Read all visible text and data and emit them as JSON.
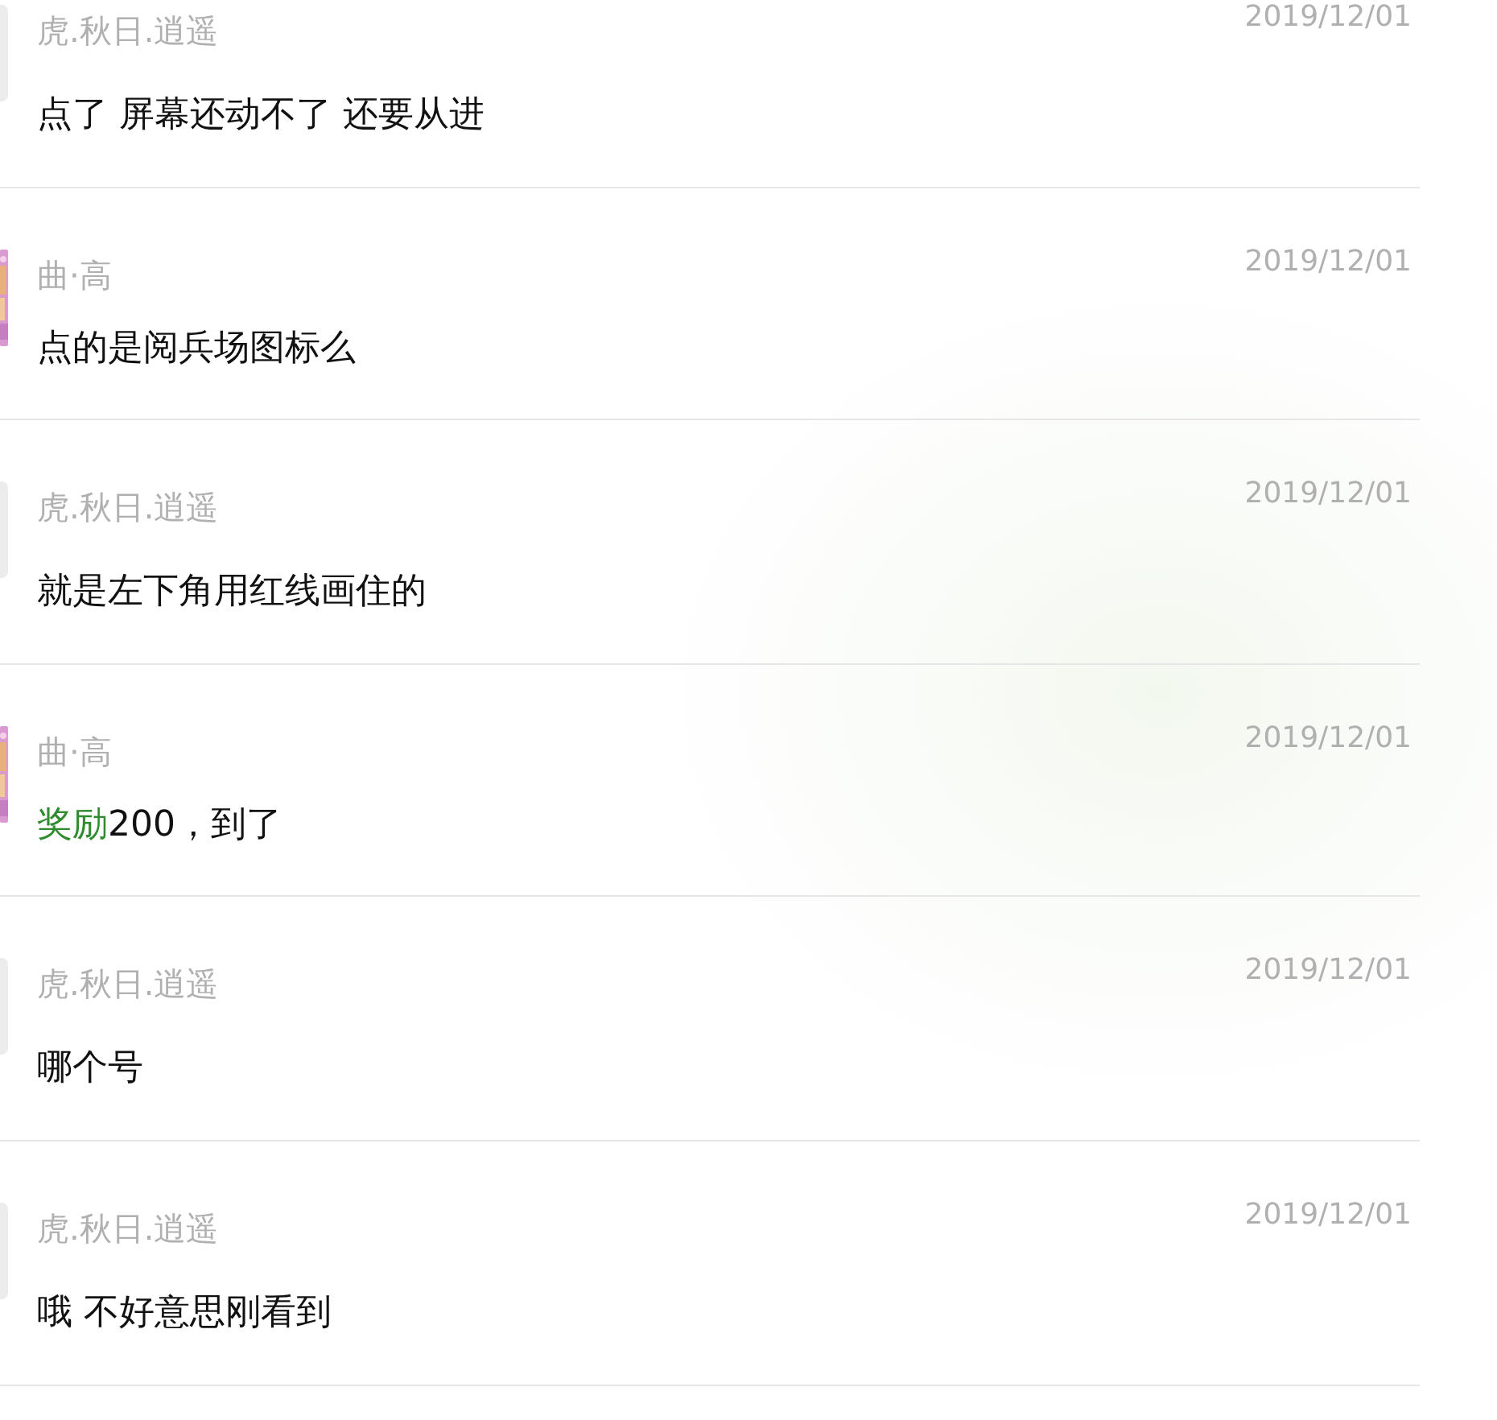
{
  "comments": [
    {
      "kind": "plain",
      "name": "虎.秋日.逍遥",
      "date": "2019/12/01",
      "message": "点了 屏幕还动不了 还要从进"
    },
    {
      "kind": "picture",
      "name": "曲·高",
      "date": "2019/12/01",
      "message": "点的是阅兵场图标么"
    },
    {
      "kind": "plain",
      "name": "虎.秋日.逍遥",
      "date": "2019/12/01",
      "message": "就是左下角用红线画住的"
    },
    {
      "kind": "picture",
      "name": "曲·高",
      "date": "2019/12/01",
      "highlight": "奖励",
      "message": "200，到了"
    },
    {
      "kind": "plain",
      "name": "虎.秋日.逍遥",
      "date": "2019/12/01",
      "message": "哪个号"
    },
    {
      "kind": "plain",
      "name": "虎.秋日.逍遥",
      "date": "2019/12/01",
      "message": "哦 不好意思刚看到"
    }
  ]
}
